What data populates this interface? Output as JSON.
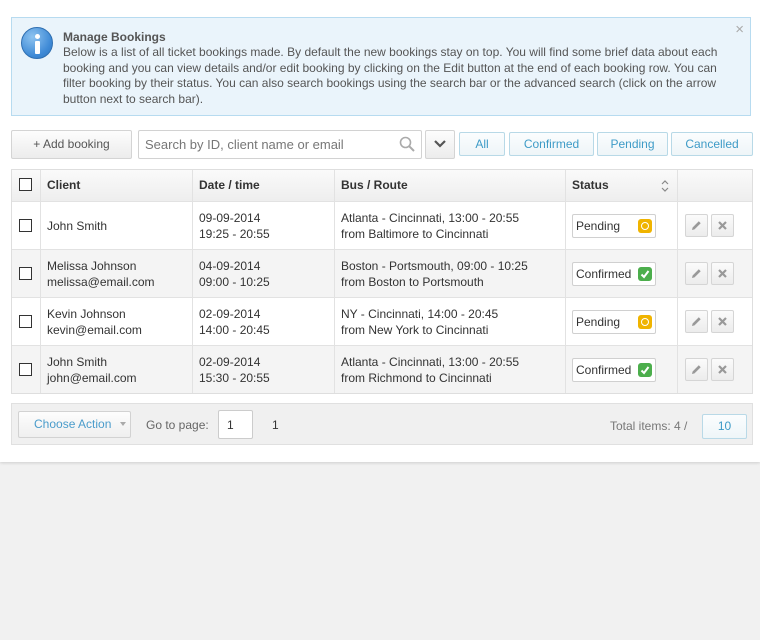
{
  "info": {
    "title": "Manage Bookings",
    "text": "Below is a list of all ticket bookings made. By default the new bookings stay on top. You will find some brief data about each booking and you can view details and/or edit booking by clicking on the Edit button at the end of each booking row. You can filter booking by their status. You can also search bookings using the search bar or the advanced search (click on the arrow button next to search bar).",
    "close": "×"
  },
  "toolbar": {
    "add_label": "+ Add booking",
    "search_placeholder": "Search by ID, client name or email",
    "filters": [
      "All",
      "Confirmed",
      "Pending",
      "Cancelled"
    ]
  },
  "table": {
    "headers": {
      "client": "Client",
      "date": "Date / time",
      "route": "Bus / Route",
      "status": "Status"
    },
    "rows": [
      {
        "client_name": "John Smith",
        "client_email": "",
        "date": "09-09-2014",
        "time": "19:25 - 20:55",
        "route": "Atlanta - Cincinnati, 13:00 - 20:55",
        "route_from": "from Baltimore to Cincinnati",
        "status": "Pending"
      },
      {
        "client_name": "Melissa Johnson",
        "client_email": "melissa@email.com",
        "date": "04-09-2014",
        "time": "09:00 - 10:25",
        "route": "Boston - Portsmouth, 09:00 - 10:25",
        "route_from": "from Boston to Portsmouth",
        "status": "Confirmed"
      },
      {
        "client_name": "Kevin Johnson",
        "client_email": "kevin@email.com",
        "date": "02-09-2014",
        "time": "14:00 - 20:45",
        "route": "NY - Cincinnati, 14:00 - 20:45",
        "route_from": "from New York to Cincinnati",
        "status": "Pending"
      },
      {
        "client_name": "John Smith",
        "client_email": "john@email.com",
        "date": "02-09-2014",
        "time": "15:30 - 20:55",
        "route": "Atlanta - Cincinnati, 13:00 - 20:55",
        "route_from": "from Richmond to Cincinnati",
        "status": "Confirmed"
      }
    ]
  },
  "footer": {
    "choose_action": "Choose Action",
    "goto_label": "Go to page:",
    "goto_value": "1",
    "page_count": "1",
    "total_label": "Total items: 4 /",
    "per_page": "10"
  },
  "colors": {
    "accent": "#3e9bc7",
    "pending": "#f0b400",
    "confirmed": "#4cae4c"
  }
}
